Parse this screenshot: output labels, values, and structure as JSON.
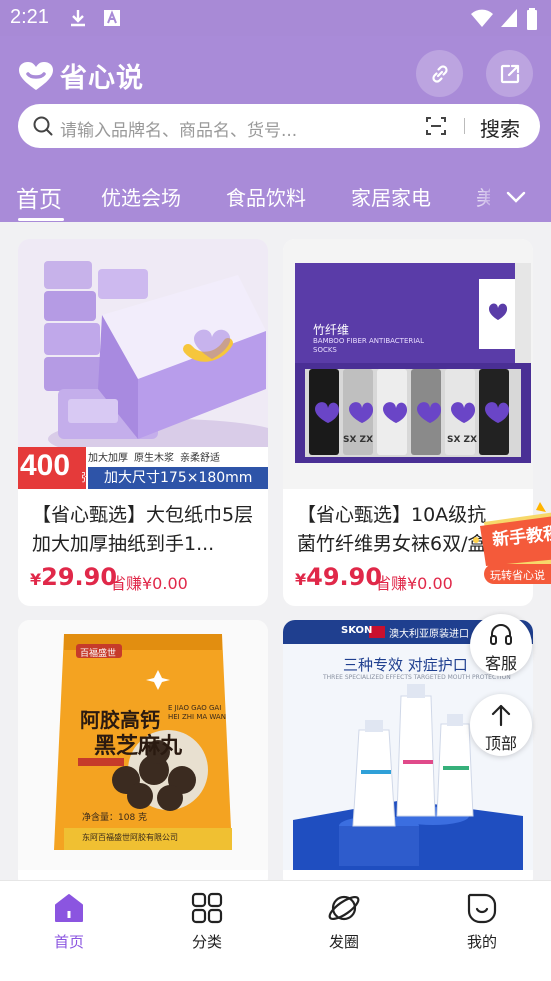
{
  "status_bar": {
    "time": "2:21"
  },
  "header": {
    "brand": "省心说",
    "search": {
      "placeholder": "请输入品牌名、商品名、货号...",
      "button": "搜索"
    },
    "tabs": [
      {
        "label": "首页",
        "active": true
      },
      {
        "label": "优选会场"
      },
      {
        "label": "食品饮料"
      },
      {
        "label": "家居家电"
      },
      {
        "label": "美"
      }
    ]
  },
  "products": [
    {
      "title": "【省心甄选】大包纸巾5层加大加厚抽纸到手1...",
      "currency": "¥",
      "price": "29.90",
      "earn": "省赚¥0.00",
      "image": {
        "badge_count": "400",
        "badge_unit": "张",
        "features": [
          "加大加厚",
          "原生木浆",
          "亲柔舒适"
        ],
        "size_text": "加大尺寸175×180mm"
      }
    },
    {
      "title": "【省心甄选】10A级抗菌竹纤维男女袜6双/盒",
      "currency": "¥",
      "price": "49.90",
      "earn": "省赚¥0.00",
      "image": {
        "box_label": "竹纤维",
        "box_sub": "BAMBOO FIBER ANTIBACTERIAL SOCKS",
        "sock_text": "SX ZX"
      }
    },
    {
      "title": "",
      "image": {
        "brand": "百福盛世",
        "name_line1": "阿胶高钙",
        "name_line2": "黑芝麻丸",
        "pinyin": "E JIAO GAO GAI HEI ZHI MA WAN",
        "weight": "净含量：108 克",
        "maker": "东阿百福盛世阿胶有限公司"
      }
    },
    {
      "title": "",
      "image": {
        "banner_brand": "SKON",
        "banner_text": "澳大利亚原装进口",
        "headline": "三种专效 对症护口",
        "sub": "THREE SPECIALIZED EFFECTS TARGETED MOUTH PROTECTION"
      }
    }
  ],
  "promo": {
    "line1": "新手教程",
    "line2": "玩转省心说"
  },
  "float": {
    "service": "客服",
    "top": "顶部"
  },
  "bottom_nav": [
    {
      "label": "首页",
      "icon": "home-icon",
      "active": true
    },
    {
      "label": "分类",
      "icon": "grid-icon"
    },
    {
      "label": "发圈",
      "icon": "planet-icon"
    },
    {
      "label": "我的",
      "icon": "smile-icon"
    }
  ],
  "colors": {
    "primary": "#a98bd8",
    "price": "#e02849",
    "nav_active": "#8b55e0"
  }
}
